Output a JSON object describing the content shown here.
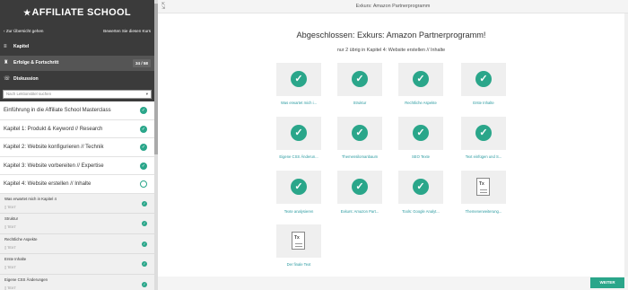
{
  "sidebar": {
    "logo": "AFFILIATE SCHOOL",
    "back_label": "Zur Übersicht gehen",
    "rate_label": "Bewerten Sie diesen Kurs",
    "nav": {
      "kapitel": "Kapitel",
      "progress": "Erfolge & Fortschritt",
      "progress_count": "34 / 58",
      "discussion": "Diskussion"
    },
    "search_placeholder": "Nach Lektionstitel suchen",
    "chapters": [
      {
        "title": "Einführung in die Affiliate School Masterclass",
        "status": "done"
      },
      {
        "title": "Kapitel 1: Produkt & Keyword // Research",
        "status": "done"
      },
      {
        "title": "Kapitel 2: Website konfigurieren // Technik",
        "status": "done"
      },
      {
        "title": "Kapitel 3: Website vorbereiten // Expertise",
        "status": "done"
      },
      {
        "title": "Kapitel 4: Website erstellen // Inhalte",
        "status": "open"
      }
    ],
    "lessons": [
      {
        "title": "Was erwartet mich in Kapitel 4",
        "type": "TEXT"
      },
      {
        "title": "Struktur",
        "type": "TEXT"
      },
      {
        "title": "Rechtliche Aspekte",
        "type": "TEXT"
      },
      {
        "title": "Erste Inhalte",
        "type": "TEXT"
      },
      {
        "title": "Eigene CSS Änderungen",
        "type": "TEXT"
      }
    ]
  },
  "topbar": {
    "title": "Exkurs: Amazon Partnerprogramm"
  },
  "main": {
    "heading": "Abgeschlossen: Exkurs: Amazon Partnerprogramm!",
    "subheading": "nur 2 übrig in Kapitel 4: Website erstellen // Inhalte",
    "tiles": [
      {
        "label": "Was erwartet mich i...",
        "status": "done"
      },
      {
        "label": "Struktur",
        "status": "done"
      },
      {
        "label": "Rechtliche Aspekte",
        "status": "done"
      },
      {
        "label": "Erste Inhalte",
        "status": "done"
      },
      {
        "label": "Eigene CSS Änderun...",
        "status": "done"
      },
      {
        "label": "Themensilomanbaum",
        "status": "done"
      },
      {
        "label": "SEO Texte",
        "status": "done"
      },
      {
        "label": "Text einfügen und S...",
        "status": "done"
      },
      {
        "label": "Texte analysieren",
        "status": "done"
      },
      {
        "label": "Exkurs: Amazon Part...",
        "status": "done"
      },
      {
        "label": "Tools: Google Analyt...",
        "status": "done"
      },
      {
        "label": "Themenerweiterung...",
        "status": "todo"
      },
      {
        "label": "Der finale Text",
        "status": "todo"
      }
    ],
    "doc_icon_text": "Tx"
  },
  "footer": {
    "next_label": "WEITER"
  },
  "colors": {
    "accent": "#2aa68a",
    "sidebar_dark": "#3b3b3b",
    "link": "#2a9aa0"
  }
}
